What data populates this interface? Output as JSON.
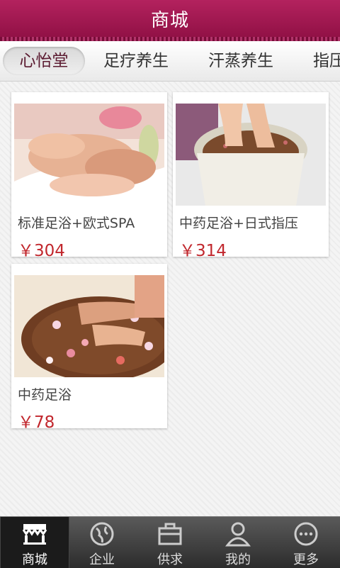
{
  "header": {
    "title": "商城"
  },
  "tabs": [
    {
      "label": "心怡堂",
      "active": true
    },
    {
      "label": "足疗养生"
    },
    {
      "label": "汗蒸养生"
    },
    {
      "label": "指压"
    }
  ],
  "products": [
    {
      "name": "标准足浴+欧式SPA",
      "price": "￥304",
      "image": "hand-massage-foot-image"
    },
    {
      "name": "中药足浴+日式指压",
      "price": "￥314",
      "image": "herbal-foot-bath-image"
    },
    {
      "name": "中药足浴",
      "price": "￥78",
      "image": "petal-foot-bath-image"
    }
  ],
  "bottom_nav": [
    {
      "label": "商城",
      "icon": "store-icon",
      "active": true
    },
    {
      "label": "企业",
      "icon": "globe-icon"
    },
    {
      "label": "供求",
      "icon": "briefcase-icon"
    },
    {
      "label": "我的",
      "icon": "person-icon"
    },
    {
      "label": "更多",
      "icon": "more-icon"
    }
  ],
  "colors": {
    "header": "#9d1650",
    "price": "#c1272d"
  }
}
